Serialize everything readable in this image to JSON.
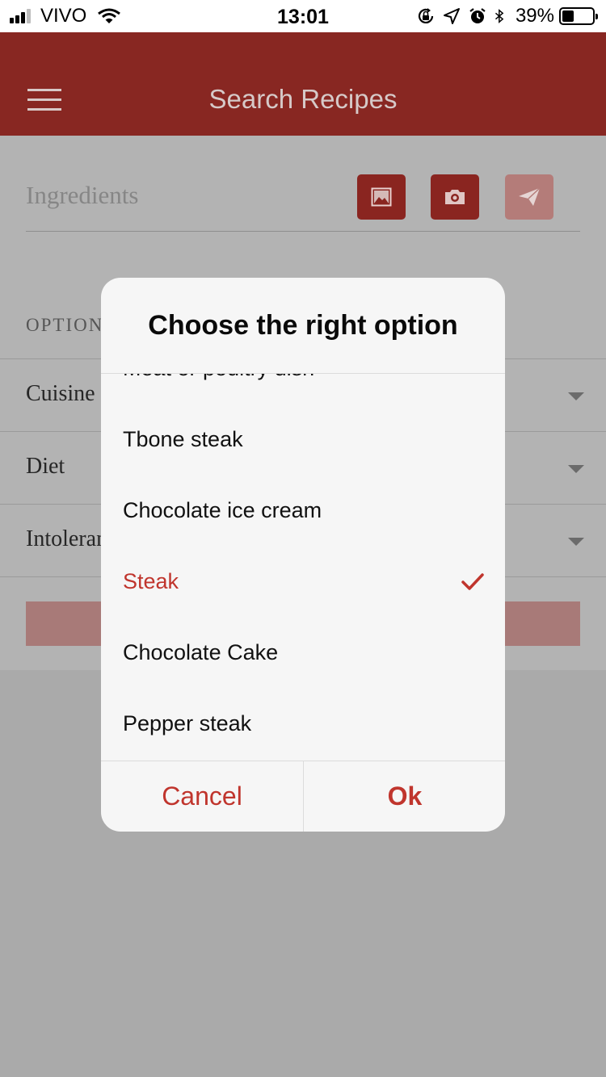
{
  "status_bar": {
    "carrier": "VIVO",
    "time": "13:01",
    "battery_percent": "39%",
    "battery_level": 0.39,
    "signal_bars": 3,
    "icons": [
      "signal-icon",
      "wifi-icon",
      "orientation-lock-icon",
      "location-icon",
      "alarm-icon",
      "bluetooth-icon",
      "battery-icon"
    ]
  },
  "header": {
    "title": "Search Recipes",
    "menu_icon": "hamburger-menu-icon"
  },
  "search": {
    "placeholder": "Ingredients",
    "buttons": [
      {
        "icon": "image-icon"
      },
      {
        "icon": "camera-icon"
      },
      {
        "icon": "send-icon"
      }
    ]
  },
  "options": {
    "label": "OPTION",
    "rows": [
      {
        "label": "Cuisine"
      },
      {
        "label": "Diet"
      },
      {
        "label": "Intoleran"
      }
    ]
  },
  "dialog": {
    "title": "Choose the right option",
    "items": [
      {
        "label": "Meat or poultry dish",
        "selected": false
      },
      {
        "label": "Tbone steak",
        "selected": false
      },
      {
        "label": "Chocolate ice cream",
        "selected": false
      },
      {
        "label": "Steak",
        "selected": true
      },
      {
        "label": "Chocolate Cake",
        "selected": false
      },
      {
        "label": "Pepper steak",
        "selected": false
      }
    ],
    "cancel_label": "Cancel",
    "ok_label": "Ok"
  },
  "colors": {
    "brand": "#882722",
    "accent": "#c0352d"
  }
}
